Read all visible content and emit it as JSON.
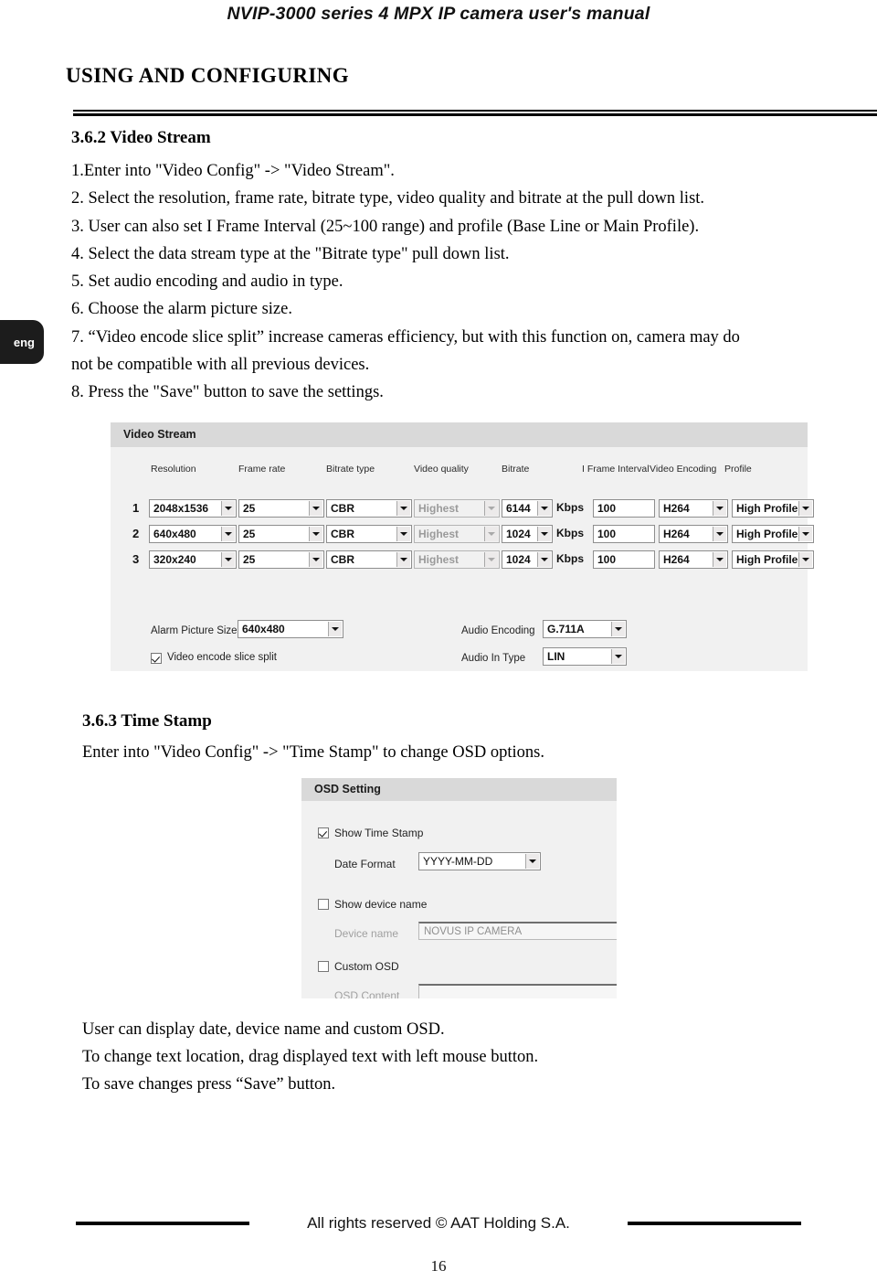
{
  "header": {
    "running_title": "NVIP-3000 series 4 MPX IP camera user's manual"
  },
  "section": {
    "title": "USING AND CONFIGURING"
  },
  "language_tab": {
    "label": "eng"
  },
  "video_stream_section": {
    "heading": "3.6.2 Video Stream",
    "steps": [
      "1.Enter into \"Video Config\" ->  \"Video Stream\".",
      "2. Select the resolution, frame rate, bitrate type, video quality and bitrate at the pull down list.",
      "3. User can also set I Frame Interval (25~100 range) and profile (Base Line or Main Profile).",
      "4. Select the data stream type at the \"Bitrate type\" pull down list.",
      "5. Set audio encoding and audio in type.",
      "6. Choose the alarm picture size.",
      "7. “Video encode slice split” increase cameras efficiency, but with this function on, camera may do",
      "not be compatible with all previous devices.",
      "8. Press the \"Save\" button to save the settings."
    ]
  },
  "video_stream_panel": {
    "title": "Video Stream",
    "column_headers": [
      "Resolution",
      "Frame rate",
      "Bitrate type",
      "Video quality",
      "Bitrate",
      "I Frame Interval",
      "Video Encoding",
      "Profile"
    ],
    "bitrate_unit": "Kbps",
    "rows": [
      {
        "index": "1",
        "resolution": "2048x1536",
        "frame_rate": "25",
        "bitrate_type": "CBR",
        "video_quality": "Highest",
        "bitrate": "6144",
        "i_frame_interval": "100",
        "video_encoding": "H264",
        "profile": "High Profile"
      },
      {
        "index": "2",
        "resolution": "640x480",
        "frame_rate": "25",
        "bitrate_type": "CBR",
        "video_quality": "Highest",
        "bitrate": "1024",
        "i_frame_interval": "100",
        "video_encoding": "H264",
        "profile": "High Profile"
      },
      {
        "index": "3",
        "resolution": "320x240",
        "frame_rate": "25",
        "bitrate_type": "CBR",
        "video_quality": "Highest",
        "bitrate": "1024",
        "i_frame_interval": "100",
        "video_encoding": "H264",
        "profile": "High Profile"
      }
    ],
    "alarm_picture_size_label": "Alarm Picture Size",
    "alarm_picture_size_value": "640x480",
    "video_encode_slice_split_label": "Video encode slice split",
    "audio_encoding_label": "Audio Encoding",
    "audio_encoding_value": "G.711A",
    "audio_in_type_label": "Audio In Type",
    "audio_in_type_value": "LIN"
  },
  "time_stamp_section": {
    "heading": "3.6.3 Time Stamp",
    "intro": "Enter into \"Video Config\" -> \"Time Stamp\" to change OSD options.",
    "notes": [
      "User can display date, device name and custom OSD.",
      "To change text location, drag displayed text with left mouse button.",
      "To save changes press “Save” button."
    ]
  },
  "osd_panel": {
    "title": "OSD Setting",
    "show_time_stamp_label": "Show Time Stamp",
    "date_format_label": "Date Format",
    "date_format_value": "YYYY-MM-DD",
    "show_device_name_label": "Show device name",
    "device_name_label": "Device name",
    "device_name_value": "NOVUS IP CAMERA",
    "custom_osd_label": "Custom OSD",
    "osd_content_label": "OSD Content",
    "osd_content_value": ""
  },
  "footer": {
    "copyright": "All rights reserved © AAT Holding S.A.",
    "page_number": "16"
  }
}
